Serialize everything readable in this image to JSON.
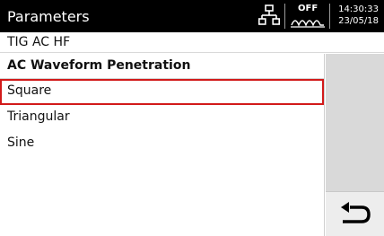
{
  "header": {
    "title": "Parameters",
    "status_off": "OFF",
    "time": "14:30:33",
    "date": "23/05/18",
    "network_icon": "network-icon",
    "wave_icon": "arc-wave-icon"
  },
  "subheader": {
    "label": "TIG AC HF"
  },
  "panel": {
    "heading": "AC Waveform Penetration",
    "options": [
      {
        "label": "Square",
        "selected": true
      },
      {
        "label": "Triangular",
        "selected": false
      },
      {
        "label": "Sine",
        "selected": false
      }
    ]
  },
  "side": {
    "back_icon": "back-arrow-icon"
  },
  "colors": {
    "topbar": "#000000",
    "selection_border": "#d21a1a",
    "side_bg": "#d9d9d9",
    "back_button_bg": "#ededed"
  }
}
